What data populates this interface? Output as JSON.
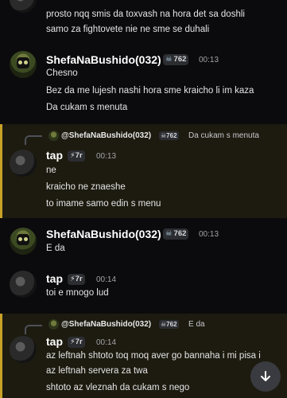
{
  "top_partial": {
    "lines": [
      "prosto nqq smis da toxvash na hora det sa doshli",
      "samo za fightovete nie ne sme se duhali"
    ]
  },
  "messages": [
    {
      "author": "ShefaNaBushido(032)",
      "badge": "762",
      "time": "00:13",
      "lines": [
        "Chesno",
        "Bez da me lujesh nashi hora sme kraicho li im kaza",
        "Da cukam s menuta"
      ]
    },
    {
      "reply": {
        "author": "@ShefaNaBushido(032)",
        "badge": "762",
        "snippet": "Da cukam s menuta"
      },
      "author": "tap",
      "badge": "7r",
      "time": "00:13",
      "lines": [
        "ne",
        "kraicho ne znaeshe",
        "to imame samo edin s menu"
      ]
    },
    {
      "author": "ShefaNaBushido(032)",
      "badge": "762",
      "time": "00:13",
      "lines": [
        "E da"
      ]
    },
    {
      "author": "tap",
      "badge": "7r",
      "time": "00:14",
      "lines": [
        "toi e mnogo lud"
      ]
    },
    {
      "reply": {
        "author": "@ShefaNaBushido(032)",
        "badge": "762",
        "snippet": "E da"
      },
      "author": "tap",
      "badge": "7r",
      "time": "00:14",
      "lines": [
        "az leftnah shtoto toq moq aver go bannaha i mi pisa i",
        "az leftnah servera za twa",
        "shtoto az vleznah da cukam s nego"
      ]
    }
  ],
  "colors": {
    "background": "#0b0b0d",
    "highlight": "#1d1b10",
    "highlight_border": "#c9a227"
  },
  "scroll_button_icon": "chevron-down-icon"
}
